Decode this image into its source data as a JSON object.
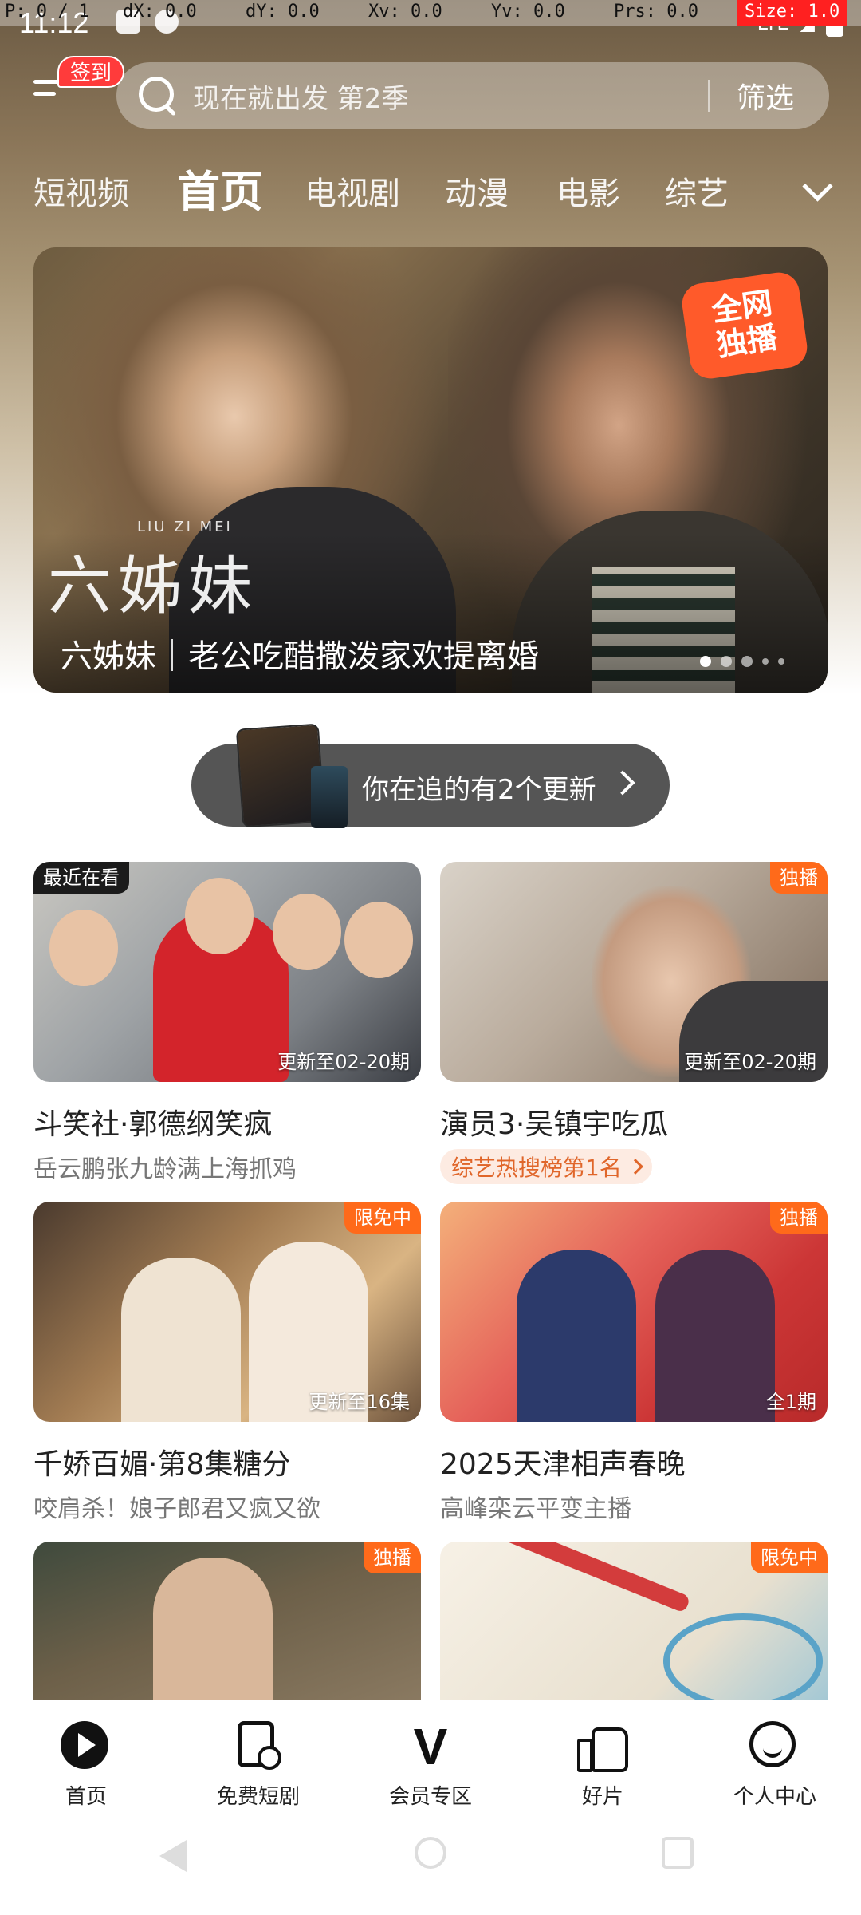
{
  "debug": {
    "pointer": "P: 0 / 1",
    "dx": "dX: 0.0",
    "dy": "dY: 0.0",
    "xv": "Xv: 0.0",
    "yv": "Yv: 0.0",
    "prs": "Prs: 0.0",
    "size": "Size: 1.0"
  },
  "status": {
    "time": "11:12",
    "network": "LTE"
  },
  "header": {
    "checkin_label": "签到",
    "search_placeholder": "现在就出发 第2季",
    "filter_label": "筛选"
  },
  "tabs": [
    {
      "label": "短视频"
    },
    {
      "label": "首页",
      "active": true
    },
    {
      "label": "电视剧"
    },
    {
      "label": "动漫"
    },
    {
      "label": "电影"
    },
    {
      "label": "综艺"
    }
  ],
  "banner": {
    "logo_text": "六姊妹",
    "logo_pinyin": "LIU ZI MEI",
    "caption": "六姊妹｜老公吃醋撒泼家欢提离婚",
    "badge_line1": "全网",
    "badge_line2": "独播",
    "dots_total": 5,
    "dots_active": 1
  },
  "follow": {
    "text": "你在追的有2个更新"
  },
  "cards": [
    {
      "tag": "最近在看",
      "tag_side": "left",
      "overlay": "更新至02-20期",
      "title": "斗笑社·郭德纲笑疯",
      "subtitle": "岳云鹏张九龄满上海抓鸡"
    },
    {
      "tag": "独播",
      "overlay": "更新至02-20期",
      "title": "演员3·吴镇宇吃瓜",
      "rank": "综艺热搜榜第1名"
    },
    {
      "tag": "限免中",
      "overlay": "更新至16集",
      "title": "千娇百媚·第8集糖分",
      "subtitle": "咬肩杀！娘子郎君又疯又欲"
    },
    {
      "tag": "独播",
      "overlay": "全1期",
      "title": "2025天津相声春晚",
      "subtitle": "高峰栾云平变主播"
    },
    {
      "tag": "独播"
    },
    {
      "tag": "限免中"
    }
  ],
  "bottom_nav": [
    {
      "label": "首页",
      "icon": "home-play-icon"
    },
    {
      "label": "免费短剧",
      "icon": "short-drama-icon"
    },
    {
      "label": "会员专区",
      "icon": "vip-icon",
      "glyph": "V"
    },
    {
      "label": "好片",
      "icon": "thumbs-up-icon"
    },
    {
      "label": "个人中心",
      "icon": "user-smile-icon"
    }
  ]
}
